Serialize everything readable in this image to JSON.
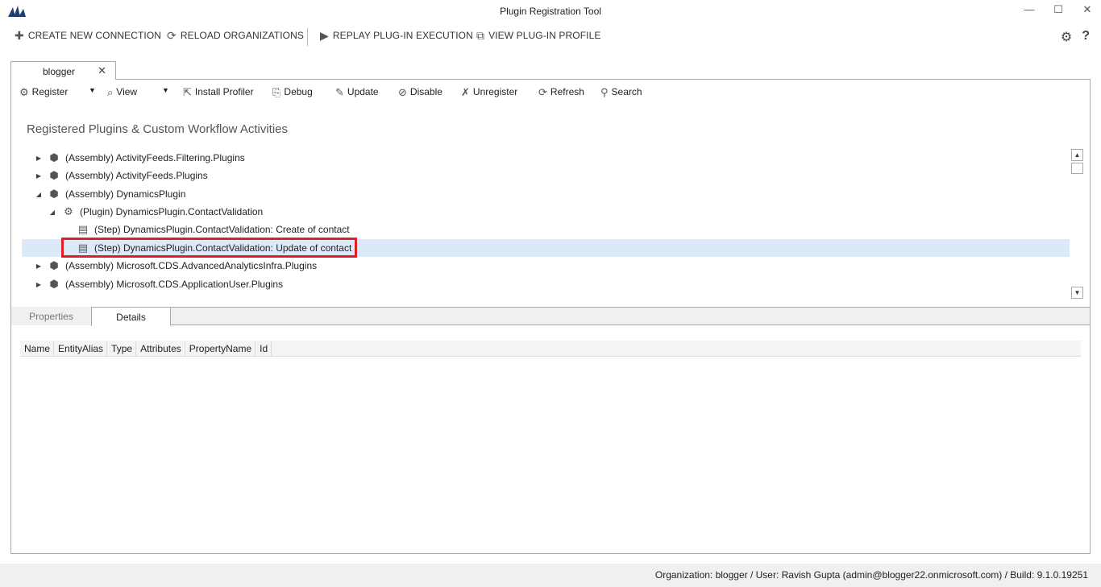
{
  "window": {
    "title": "Plugin Registration Tool",
    "controls": {
      "minimize": "—",
      "maximize": "☐",
      "close": "✕"
    }
  },
  "commands": [
    {
      "label": "CREATE NEW CONNECTION",
      "icon": "plus-icon",
      "glyph": "✚"
    },
    {
      "label": "RELOAD ORGANIZATIONS",
      "icon": "reload-icon",
      "glyph": "⟳"
    },
    {
      "label": "REPLAY PLUG-IN EXECUTION",
      "icon": "replay-icon",
      "glyph": "▶"
    },
    {
      "label": "VIEW PLUG-IN PROFILE",
      "icon": "profile-icon",
      "glyph": "⧉"
    }
  ],
  "top_right": {
    "settings_glyph": "⚙",
    "help_glyph": "?"
  },
  "tab": {
    "label": "blogger",
    "close_glyph": "✕"
  },
  "toolbar": [
    {
      "label": "Register",
      "icon": "register-icon",
      "glyph": "⚙"
    },
    {
      "label": "View",
      "icon": "view-icon",
      "glyph": "⌕"
    },
    {
      "label": "Install Profiler",
      "icon": "install-profiler-icon",
      "glyph": "⇱"
    },
    {
      "label": "Debug",
      "icon": "debug-icon",
      "glyph": "⎘"
    },
    {
      "label": "Update",
      "icon": "update-icon",
      "glyph": "✎"
    },
    {
      "label": "Disable",
      "icon": "disable-icon",
      "glyph": "⊘"
    },
    {
      "label": "Unregister",
      "icon": "unregister-icon",
      "glyph": "✗"
    },
    {
      "label": "Refresh",
      "icon": "refresh-icon",
      "glyph": "⟳"
    },
    {
      "label": "Search",
      "icon": "search-icon",
      "glyph": "⚲"
    }
  ],
  "section_title": "Registered Plugins & Custom Workflow Activities",
  "tree": [
    {
      "text": "(Assembly) ActivityFeeds.Filtering.Plugins",
      "level": 0,
      "expander": "▶",
      "icon": "assembly-icon",
      "glyph": "⬢",
      "selected": false
    },
    {
      "text": "(Assembly) ActivityFeeds.Plugins",
      "level": 0,
      "expander": "▶",
      "icon": "assembly-icon",
      "glyph": "⬢",
      "selected": false
    },
    {
      "text": "(Assembly) DynamicsPlugin",
      "level": 0,
      "expander": "◢",
      "icon": "assembly-icon",
      "glyph": "⬢",
      "selected": false
    },
    {
      "text": "(Plugin) DynamicsPlugin.ContactValidation",
      "level": 1,
      "expander": "◢",
      "icon": "plugin-icon",
      "glyph": "⚙",
      "selected": false
    },
    {
      "text": "(Step) DynamicsPlugin.ContactValidation: Create of contact",
      "level": 2,
      "expander": "",
      "icon": "step-icon",
      "glyph": "▤",
      "selected": false
    },
    {
      "text": "(Step) DynamicsPlugin.ContactValidation: Update of contact",
      "level": 2,
      "expander": "",
      "icon": "step-icon",
      "glyph": "▤",
      "selected": true
    },
    {
      "text": "(Assembly) Microsoft.CDS.AdvancedAnalyticsInfra.Plugins",
      "level": 0,
      "expander": "▶",
      "icon": "assembly-icon",
      "glyph": "⬢",
      "selected": false
    },
    {
      "text": "(Assembly) Microsoft.CDS.ApplicationUser.Plugins",
      "level": 0,
      "expander": "▶",
      "icon": "assembly-icon",
      "glyph": "⬢",
      "selected": false
    }
  ],
  "scroll": {
    "up": "▲",
    "down": "▼"
  },
  "lower_tabs": {
    "properties": "Properties",
    "details": "Details"
  },
  "grid_columns": [
    "Name",
    "EntityAlias",
    "Type",
    "Attributes",
    "PropertyName",
    "Id"
  ],
  "status": "Organization: blogger / User: Ravish Gupta (admin@blogger22.onmicrosoft.com) / Build: 9.1.0.19251",
  "colors": {
    "selection": "#dbe9f9",
    "highlight_border": "#e01e24",
    "logo": "#1f3e73"
  }
}
